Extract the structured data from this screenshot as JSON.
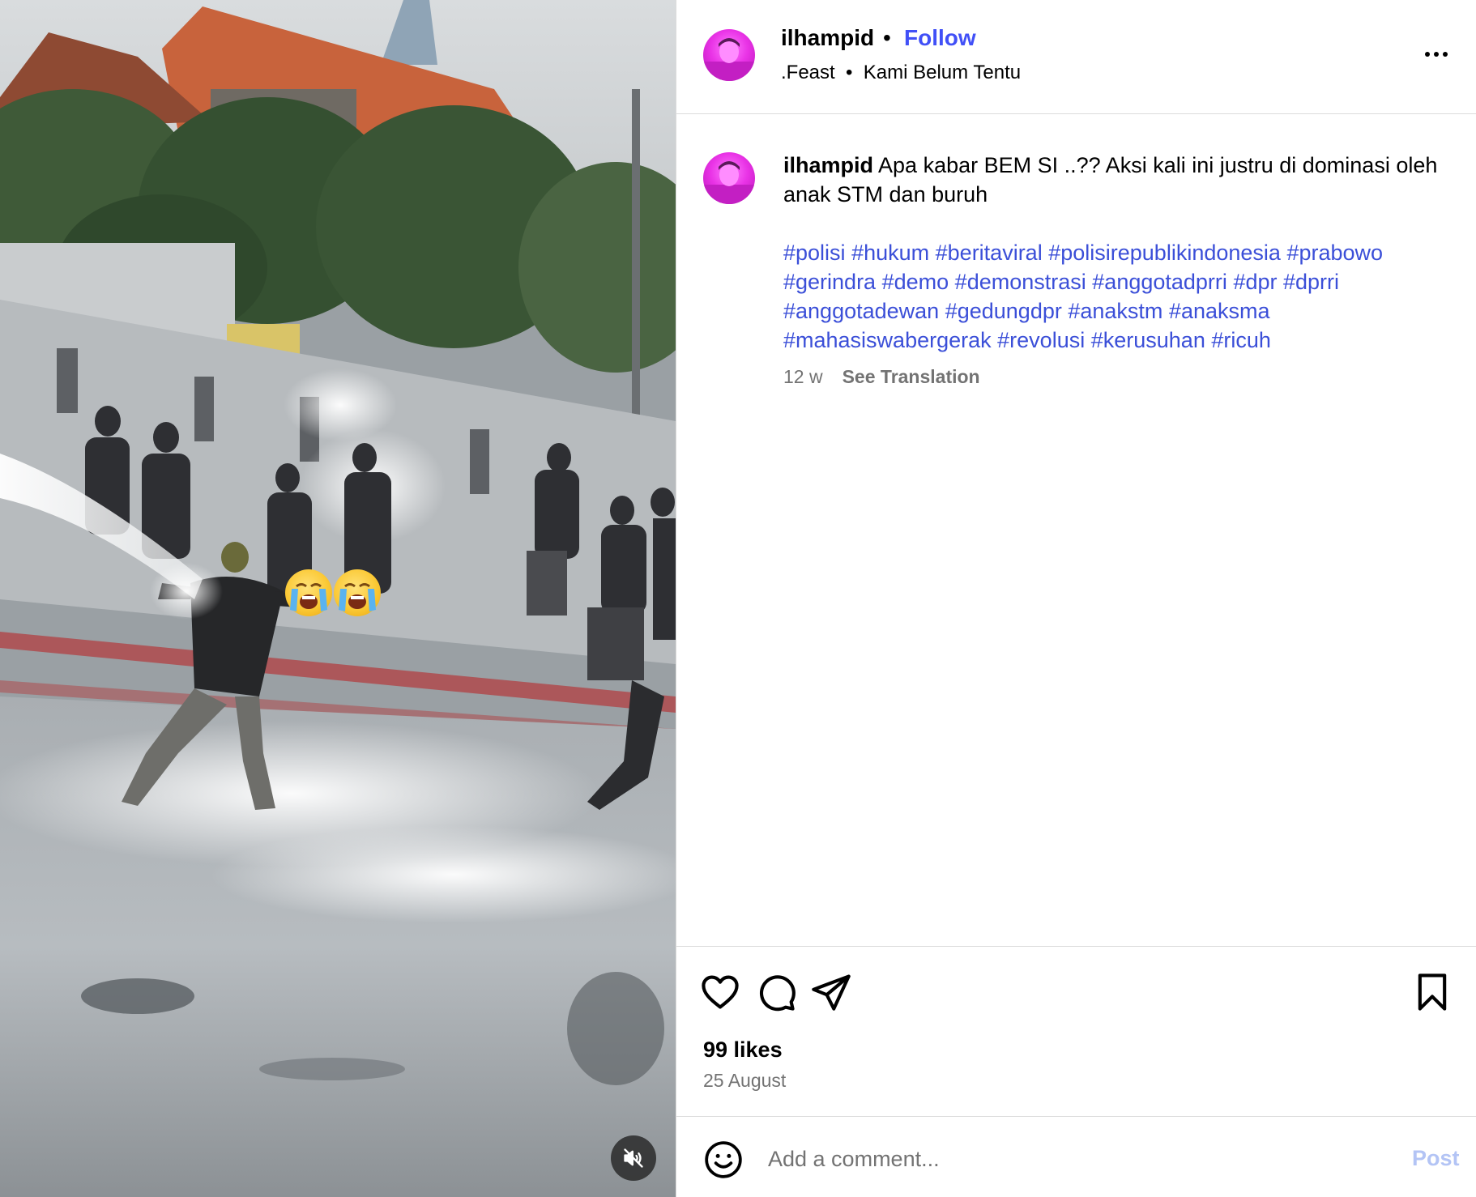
{
  "post": {
    "username": "ilhampid",
    "separator": "•",
    "follow_label": "Follow",
    "audio": ".Feast  •  Kami Belum Tentu",
    "more_icon": "more-horizontal-icon"
  },
  "caption": {
    "username": "ilhampid",
    "text": "Apa kabar BEM SI ..?? Aksi kali ini justru di dominasi oleh anak STM dan buruh",
    "hashtags": [
      "#polisi",
      "#hukum",
      "#beritaviral",
      "#polisirepublikindonesia",
      "#prabowo",
      "#gerindra",
      "#demo",
      "#demonstrasi",
      "#anggotadprri",
      "#dpr",
      "#dprri",
      "#anggotadewan",
      "#gedungdpr",
      "#anakstm",
      "#anaksma",
      "#mahasiswabergerak",
      "#revolusi",
      "#kerusuhan",
      "#ricuh"
    ],
    "age": "12 w",
    "see_translation": "See Translation"
  },
  "actions": {
    "icons": [
      "heart-icon",
      "comment-icon",
      "share-icon",
      "bookmark-icon"
    ]
  },
  "stats": {
    "likes": "99 likes",
    "date": "25 August"
  },
  "comment": {
    "placeholder": "Add a comment...",
    "post_label": "Post"
  },
  "media": {
    "mute_icon": "muted-speaker-icon",
    "overlay_emoji": [
      "loudly-crying-face",
      "loudly-crying-face"
    ]
  },
  "colors": {
    "link_blue": "#4150f7",
    "hashtag_blue": "#3b4fd8",
    "post_button_disabled": "#b3c4f5",
    "muted_text": "#737373",
    "divider": "#dbdbdb"
  }
}
